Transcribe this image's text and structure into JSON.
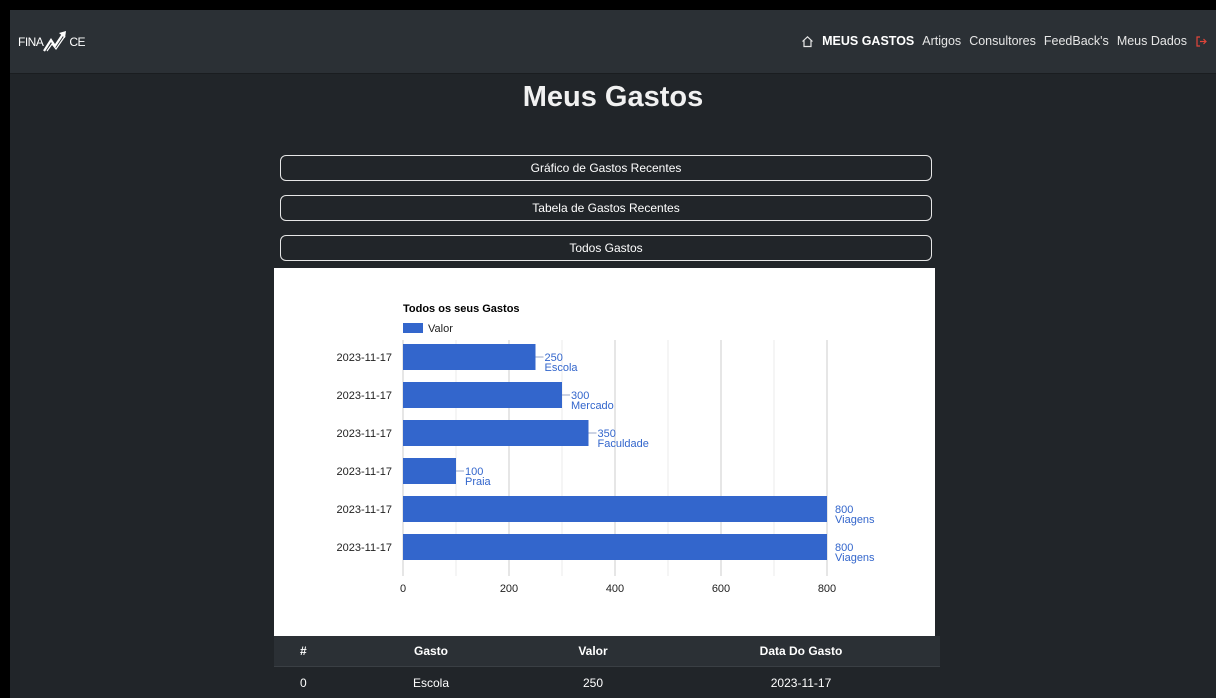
{
  "brand": {
    "text_left": "FINA",
    "text_right": "CE"
  },
  "nav": {
    "items": [
      {
        "label": "MEUS GASTOS",
        "active": true
      },
      {
        "label": "Artigos"
      },
      {
        "label": "Consultores"
      },
      {
        "label": "FeedBack's"
      },
      {
        "label": "Meus Dados"
      }
    ],
    "icons": {
      "home": "home-icon",
      "logout": "logout-icon"
    },
    "logout_color": "#e0453a"
  },
  "page": {
    "title": "Meus Gastos"
  },
  "accordion": [
    {
      "label": "Gráfico de Gastos Recentes"
    },
    {
      "label": "Tabela de Gastos Recentes"
    },
    {
      "label": "Todos Gastos"
    }
  ],
  "chart_data": {
    "type": "bar",
    "orientation": "horizontal",
    "title": "Todos os seus Gastos",
    "legend": {
      "label": "Valor",
      "position": "top-left"
    },
    "color": "#3366cc",
    "categories": [
      "2023-11-17",
      "2023-11-17",
      "2023-11-17",
      "2023-11-17",
      "2023-11-17",
      "2023-11-17"
    ],
    "values": [
      250,
      300,
      350,
      100,
      800,
      800
    ],
    "annotations": [
      "Escola",
      "Mercado",
      "Faculdade",
      "Praia",
      "Viagens",
      "Viagens"
    ],
    "xlim": [
      0,
      800
    ],
    "xticks": [
      0,
      200,
      400,
      600,
      800
    ],
    "grid": true
  },
  "table": {
    "headers": [
      "#",
      "Gasto",
      "Valor",
      "Data Do Gasto"
    ],
    "rows": [
      [
        "0",
        "Escola",
        "250",
        "2023-11-17"
      ]
    ]
  }
}
